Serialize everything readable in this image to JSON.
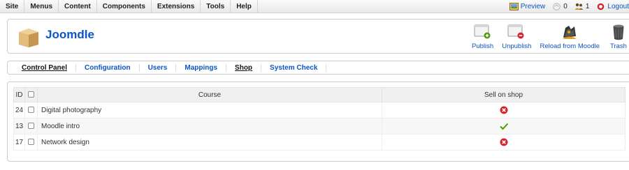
{
  "menubar": {
    "items": [
      {
        "label": "Site"
      },
      {
        "label": "Menus"
      },
      {
        "label": "Content"
      },
      {
        "label": "Components"
      },
      {
        "label": "Extensions"
      },
      {
        "label": "Tools"
      },
      {
        "label": "Help"
      }
    ],
    "status": {
      "preview_label": "Preview",
      "messages_count": "0",
      "users_count": "1",
      "logout_label": "Logout"
    }
  },
  "header": {
    "title": "Joomdle",
    "toolbar": {
      "publish_label": "Publish",
      "unpublish_label": "Unpublish",
      "reload_label": "Reload from Moodle",
      "trash_label": "Trash"
    }
  },
  "submenu": {
    "items": [
      {
        "label": "Control Panel"
      },
      {
        "label": "Configuration"
      },
      {
        "label": "Users"
      },
      {
        "label": "Mappings"
      },
      {
        "label": "Shop"
      },
      {
        "label": "System Check"
      }
    ]
  },
  "table": {
    "headers": {
      "id": "ID",
      "course": "Course",
      "sell": "Sell on shop"
    },
    "rows": [
      {
        "id": "24",
        "course": "Digital photography",
        "sell_on_shop": false
      },
      {
        "id": "13",
        "course": "Moodle intro",
        "sell_on_shop": true
      },
      {
        "id": "17",
        "course": "Network design",
        "sell_on_shop": false
      }
    ]
  },
  "colors": {
    "link": "#0b55c4",
    "unpublished": "#d8232a",
    "published": "#4e9a06"
  }
}
